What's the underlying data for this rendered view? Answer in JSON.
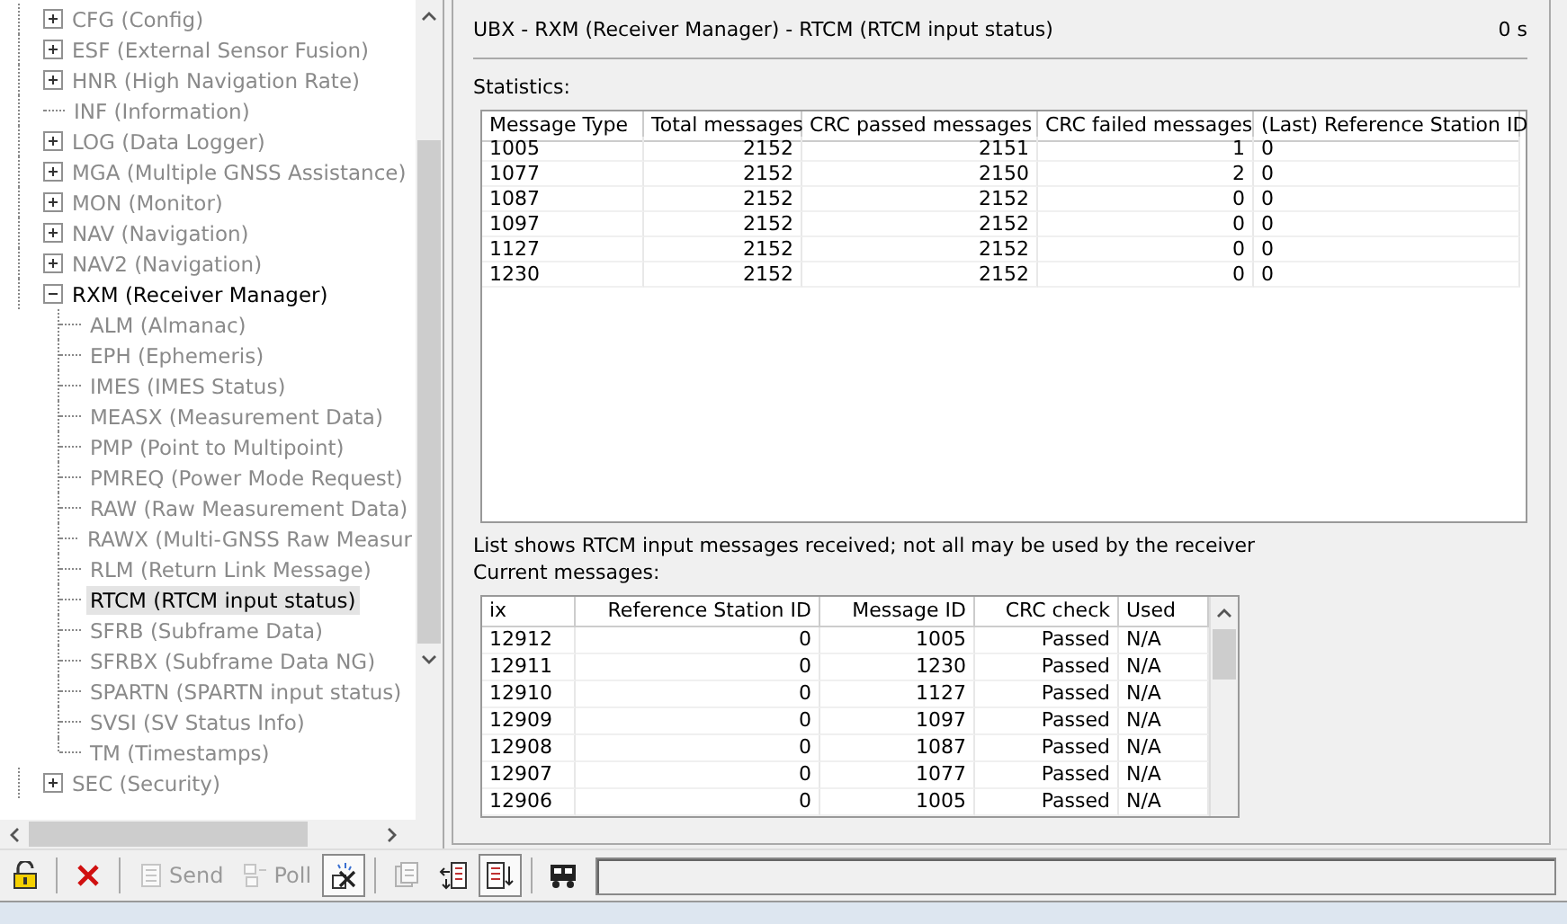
{
  "tree": [
    {
      "label": "CFG (Config)",
      "kind": "group",
      "expanded": false,
      "active": false
    },
    {
      "label": "ESF (External Sensor Fusion)",
      "kind": "group",
      "expanded": false,
      "active": false
    },
    {
      "label": "HNR (High Navigation Rate)",
      "kind": "group",
      "expanded": false,
      "active": false
    },
    {
      "label": "INF (Information)",
      "kind": "leaf",
      "active": false
    },
    {
      "label": "LOG (Data Logger)",
      "kind": "group",
      "expanded": false,
      "active": false
    },
    {
      "label": "MGA (Multiple GNSS Assistance)",
      "kind": "group",
      "expanded": false,
      "active": false
    },
    {
      "label": "MON (Monitor)",
      "kind": "group",
      "expanded": false,
      "active": false
    },
    {
      "label": "NAV (Navigation)",
      "kind": "group",
      "expanded": false,
      "active": false
    },
    {
      "label": "NAV2 (Navigation)",
      "kind": "group",
      "expanded": false,
      "active": false
    },
    {
      "label": "RXM (Receiver Manager)",
      "kind": "group",
      "expanded": true,
      "active": true,
      "children": [
        {
          "label": "ALM (Almanac)",
          "kind": "leaf",
          "active": false,
          "selected": false
        },
        {
          "label": "EPH (Ephemeris)",
          "kind": "leaf",
          "active": false,
          "selected": false
        },
        {
          "label": "IMES (IMES Status)",
          "kind": "leaf",
          "active": false,
          "selected": false
        },
        {
          "label": "MEASX (Measurement Data)",
          "kind": "leaf",
          "active": false,
          "selected": false
        },
        {
          "label": "PMP (Point to Multipoint)",
          "kind": "leaf",
          "active": false,
          "selected": false
        },
        {
          "label": "PMREQ (Power Mode Request)",
          "kind": "leaf",
          "active": false,
          "selected": false
        },
        {
          "label": "RAW (Raw Measurement Data)",
          "kind": "leaf",
          "active": false,
          "selected": false
        },
        {
          "label": "RAWX (Multi-GNSS Raw Measur",
          "kind": "leaf",
          "active": false,
          "selected": false
        },
        {
          "label": "RLM (Return Link Message)",
          "kind": "leaf",
          "active": false,
          "selected": false
        },
        {
          "label": "RTCM (RTCM input status)",
          "kind": "leaf",
          "active": true,
          "selected": true
        },
        {
          "label": "SFRB (Subframe Data)",
          "kind": "leaf",
          "active": false,
          "selected": false
        },
        {
          "label": "SFRBX (Subframe Data NG)",
          "kind": "leaf",
          "active": false,
          "selected": false
        },
        {
          "label": "SPARTN (SPARTN input status)",
          "kind": "leaf",
          "active": false,
          "selected": false
        },
        {
          "label": "SVSI (SV Status Info)",
          "kind": "leaf",
          "active": false,
          "selected": false
        },
        {
          "label": "TM (Timestamps)",
          "kind": "leaf",
          "active": false,
          "selected": false
        }
      ]
    },
    {
      "label": "SEC (Security)",
      "kind": "group",
      "expanded": false,
      "active": false
    }
  ],
  "view": {
    "title": "UBX - RXM (Receiver Manager) - RTCM (RTCM input status)",
    "age": "0 s",
    "statistics_label": "Statistics:",
    "statistics": {
      "columns": [
        "Message Type",
        "Total messages",
        "CRC passed messages",
        "CRC failed messages",
        "(Last) Reference Station ID"
      ],
      "rows": [
        [
          "1005",
          "2152",
          "2151",
          "1",
          "0"
        ],
        [
          "1077",
          "2152",
          "2150",
          "2",
          "0"
        ],
        [
          "1087",
          "2152",
          "2152",
          "0",
          "0"
        ],
        [
          "1097",
          "2152",
          "2152",
          "0",
          "0"
        ],
        [
          "1127",
          "2152",
          "2152",
          "0",
          "0"
        ],
        [
          "1230",
          "2152",
          "2152",
          "0",
          "0"
        ]
      ]
    },
    "note": "List shows RTCM input messages received; not all may be used by the receiver",
    "current_label": "Current messages:",
    "current": {
      "columns": [
        "ix",
        "Reference Station ID",
        "Message ID",
        "CRC check",
        "Used"
      ],
      "rows": [
        [
          "12912",
          "0",
          "1005",
          "Passed",
          "N/A"
        ],
        [
          "12911",
          "0",
          "1230",
          "Passed",
          "N/A"
        ],
        [
          "12910",
          "0",
          "1127",
          "Passed",
          "N/A"
        ],
        [
          "12909",
          "0",
          "1097",
          "Passed",
          "N/A"
        ],
        [
          "12908",
          "0",
          "1087",
          "Passed",
          "N/A"
        ],
        [
          "12907",
          "0",
          "1077",
          "Passed",
          "N/A"
        ],
        [
          "12906",
          "0",
          "1005",
          "Passed",
          "N/A"
        ]
      ]
    }
  },
  "toolbar": [
    {
      "kind": "icon",
      "disabled": false,
      "pressed": false
    },
    {
      "kind": "separator"
    },
    {
      "kind": "icon",
      "disabled": false,
      "pressed": false
    },
    {
      "kind": "separator"
    },
    {
      "kind": "text",
      "label": "Send",
      "disabled": true,
      "pressed": false
    },
    {
      "kind": "text",
      "label": "Poll",
      "disabled": true,
      "pressed": false
    },
    {
      "kind": "icon",
      "disabled": false,
      "pressed": true
    },
    {
      "kind": "separator"
    },
    {
      "kind": "icon",
      "disabled": true,
      "pressed": false
    },
    {
      "kind": "icon",
      "disabled": false,
      "pressed": false
    },
    {
      "kind": "icon",
      "disabled": false,
      "pressed": true
    },
    {
      "kind": "separator"
    },
    {
      "kind": "icon",
      "disabled": false,
      "pressed": false
    }
  ]
}
